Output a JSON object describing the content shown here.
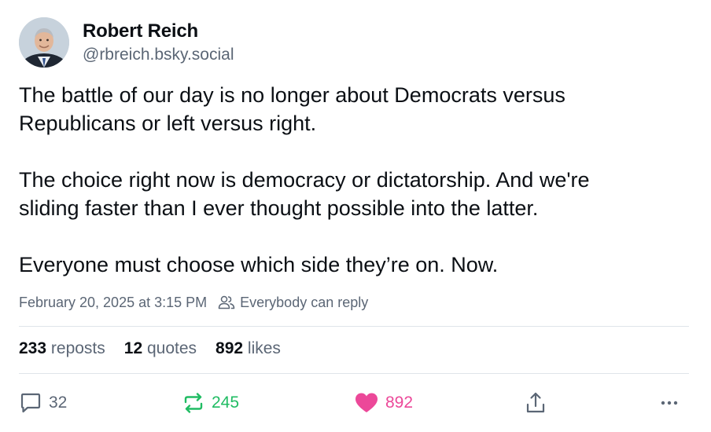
{
  "author": {
    "name": "Robert Reich",
    "handle": "@rbreich.bsky.social"
  },
  "post": {
    "paragraphs": [
      [
        "The battle of our day is no longer about Democrats versus",
        "Republicans or left versus right."
      ],
      [
        "The choice right now is democracy or dictatorship. And we're",
        "sliding faster than I ever thought possible into the latter."
      ],
      [
        "Everyone must choose which side they’re on. Now."
      ]
    ],
    "timestamp": "February 20, 2025 at 3:15 PM",
    "reply_setting": "Everybody can reply"
  },
  "stats": {
    "reposts": {
      "count": "233",
      "label": "reposts"
    },
    "quotes": {
      "count": "12",
      "label": "quotes"
    },
    "likes": {
      "count": "892",
      "label": "likes"
    }
  },
  "actions": {
    "reply_count": "32",
    "repost_count": "245",
    "like_count": "892",
    "icons": [
      "speech-bubble-icon",
      "repost-icon",
      "heart-icon",
      "share-icon",
      "more-icon"
    ]
  },
  "colors": {
    "text": "#0b0f14",
    "muted": "#5b6675",
    "repost_active": "#20bc63",
    "like_active": "#ec4899",
    "divider": "#dfe4ea"
  }
}
